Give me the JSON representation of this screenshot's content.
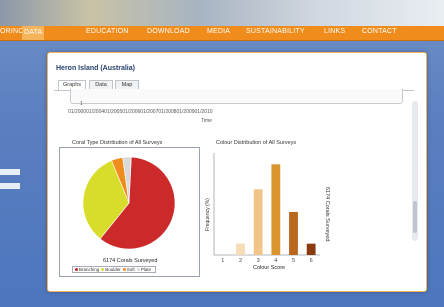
{
  "nav": {
    "items": [
      "ORINO",
      "DATA",
      "EDUCATION",
      "DOWNLOAD",
      "MEDIA",
      "SUSTAINABILITY",
      "LINKS",
      "CONTACT"
    ],
    "active": "DATA"
  },
  "panel": {
    "title": "Heron Island (Australia)",
    "tabs": [
      {
        "label": "Graphs",
        "active": true
      },
      {
        "label": "Data",
        "active": false
      },
      {
        "label": "Map",
        "active": false
      }
    ],
    "top_chart": {
      "y_tick": "1",
      "x_ticks": "01/200001/200401/200501/200601/200701/200801/200901/2010",
      "x_label": "Time"
    }
  },
  "chart_data": [
    {
      "type": "pie",
      "title": "Coral Type Distribution of All Surveys",
      "caption": "6174 Corals Surveyed",
      "categories": [
        "Branching",
        "Boulder",
        "Soft",
        "Plate"
      ],
      "values": [
        60,
        33,
        4,
        3
      ],
      "colors": [
        "#cc2a2a",
        "#d8dc2a",
        "#f08c1c",
        "#d9d9d9"
      ]
    },
    {
      "type": "bar",
      "title": "Colour Distribution of All Surveys",
      "xlabel": "Colour Score",
      "ylabel": "Frequency (%)",
      "side_label": "6174 Corals Surveyed",
      "categories": [
        "1",
        "2",
        "3",
        "4",
        "5",
        "6"
      ],
      "values": [
        0,
        5,
        29,
        40,
        19,
        5
      ],
      "colors": [
        "#fbe6cc",
        "#f7dcb8",
        "#f1c58a",
        "#d9962f",
        "#b8671c",
        "#8b3a0e"
      ],
      "ylim": [
        0,
        45
      ]
    }
  ]
}
